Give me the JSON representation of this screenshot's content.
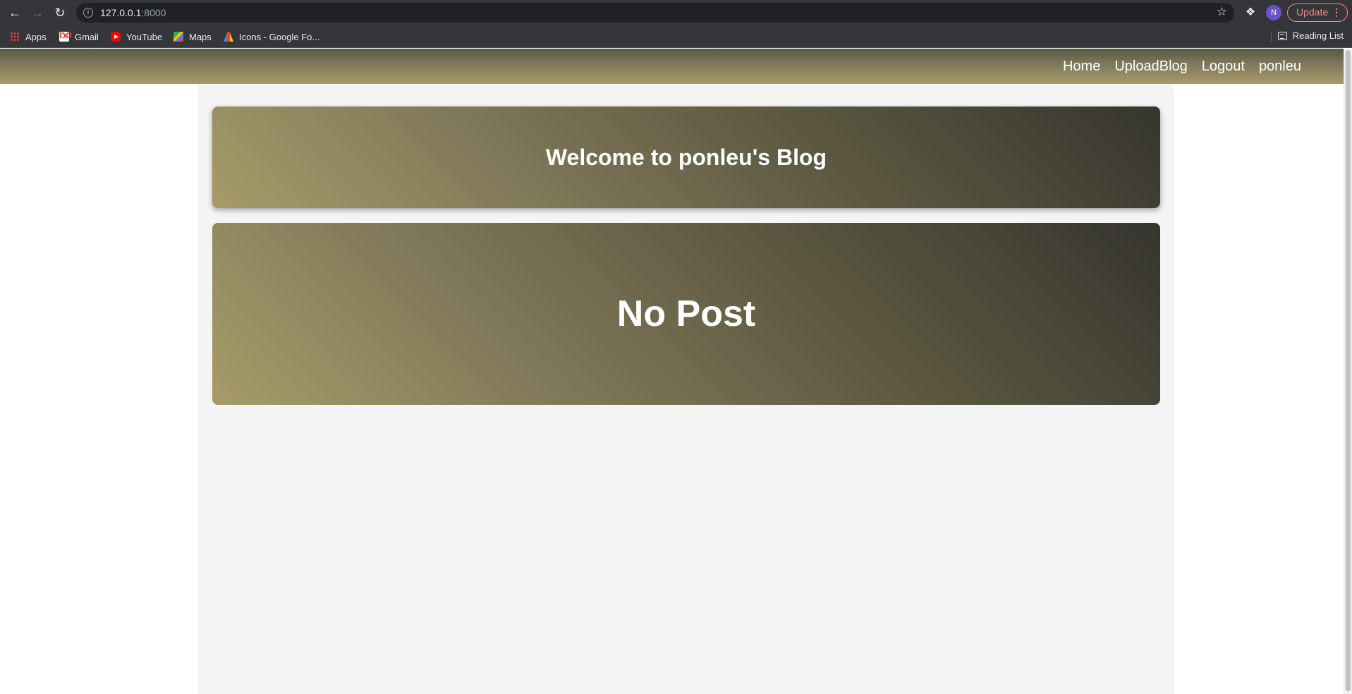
{
  "browser": {
    "url_host": "127.0.0.1",
    "url_port": ":8000",
    "update_label": "Update",
    "profile_initial": "N",
    "bookmarks": [
      {
        "label": "Apps",
        "icon": "apps-icon"
      },
      {
        "label": "Gmail",
        "icon": "gmail-icon"
      },
      {
        "label": "YouTube",
        "icon": "youtube-icon"
      },
      {
        "label": "Maps",
        "icon": "maps-icon"
      },
      {
        "label": "Icons - Google Fo...",
        "icon": "google-fonts-icon"
      }
    ],
    "reading_list": "Reading List"
  },
  "site": {
    "nav": [
      "Home",
      "UploadBlog",
      "Logout",
      "ponleu"
    ],
    "welcome": "Welcome to ponleu's Blog",
    "no_post": "No Post"
  },
  "colors": {
    "nav_gradient_start": "#595742",
    "nav_gradient_end": "#a89a6a",
    "card_dark": "#36352f",
    "card_light": "#a69b68",
    "container_bg": "#f4f4f4"
  }
}
